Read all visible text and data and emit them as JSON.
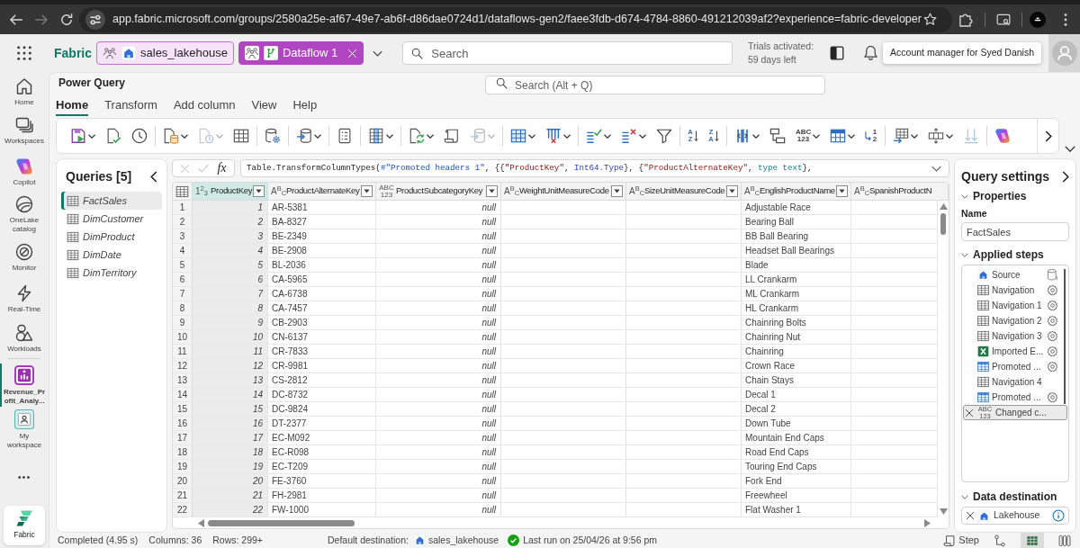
{
  "browser": {
    "nav_buttons": [
      {
        "kind": "back",
        "disabled": false
      },
      {
        "kind": "forward",
        "disabled": true
      },
      {
        "kind": "reload",
        "disabled": false
      }
    ],
    "url": "app.fabric.microsoft.com/groups/2580a25e-af67-49e7-ab6f-d86dae0724d1/dataflows-gen2/faee3fdb-d674-4784-8860-491212039af2?experience=fabric-developer"
  },
  "app_bar": {
    "brand": "Fabric",
    "breadcrumbs": [
      {
        "label": "sales_lakehouse",
        "kind": "lakehouse",
        "selected": false,
        "closable": false
      },
      {
        "label": "Dataflow 1",
        "kind": "dataflow",
        "selected": true,
        "closable": true
      }
    ],
    "search": {
      "placeholder": "Search"
    },
    "trial": {
      "title": "Trials activated:",
      "detail": "59 days left"
    },
    "tooltip": "Account manager for Syed Danish"
  },
  "nav": {
    "items": [
      {
        "label": "Home",
        "kind": "home",
        "selected": false
      },
      {
        "label": "Workspaces",
        "kind": "workspaces",
        "selected": false
      },
      {
        "label": "Copilot",
        "kind": "copilot",
        "selected": false
      },
      {
        "label": "OneLake catalog",
        "kind": "catalog",
        "selected": false
      },
      {
        "label": "Monitor",
        "kind": "monitor",
        "selected": false
      },
      {
        "label": "Real-Time",
        "kind": "realtime",
        "selected": false
      },
      {
        "label": "Workloads",
        "kind": "workloads",
        "selected": false
      }
    ],
    "open_items": [
      {
        "label": "Revenue_Profit_Analy...",
        "kind": "dataflow",
        "selected": true
      },
      {
        "label": "My workspace",
        "kind": "workspace",
        "selected": false
      }
    ],
    "more": "•••",
    "footer": {
      "label": "Fabric"
    }
  },
  "power_query": {
    "title": "Power Query",
    "search": {
      "placeholder": "Search (Alt + Q)"
    },
    "tabs": [
      {
        "label": "Home",
        "selected": true
      },
      {
        "label": "Transform",
        "selected": false
      },
      {
        "label": "Add column",
        "selected": false
      },
      {
        "label": "View",
        "selected": false
      },
      {
        "label": "Help",
        "selected": false
      }
    ]
  },
  "ribbon": {
    "groups": [
      [
        {
          "kind": "save",
          "dropdown": true,
          "disabled": false
        },
        {
          "kind": "validate",
          "dropdown": false,
          "disabled": false
        },
        {
          "kind": "schedule",
          "dropdown": false,
          "disabled": false
        }
      ],
      [
        {
          "kind": "get_data",
          "dropdown": true,
          "disabled": false
        },
        {
          "kind": "recent",
          "dropdown": true,
          "disabled": true
        },
        {
          "kind": "enter_data",
          "dropdown": false,
          "disabled": false
        }
      ],
      [
        {
          "kind": "options",
          "dropdown": false,
          "disabled": false
        }
      ],
      [
        {
          "kind": "destination",
          "dropdown": true,
          "disabled": false
        }
      ],
      [
        {
          "kind": "parameters",
          "dropdown": false,
          "disabled": false
        }
      ],
      [
        {
          "kind": "columns",
          "dropdown": true,
          "disabled": false
        }
      ],
      [
        {
          "kind": "refresh",
          "dropdown": true,
          "disabled": false
        },
        {
          "kind": "editor",
          "dropdown": false,
          "disabled": false
        },
        {
          "kind": "destination",
          "dropdown": true,
          "disabled": true
        }
      ],
      [
        {
          "kind": "choose_columns",
          "dropdown": true,
          "disabled": false
        },
        {
          "kind": "remove_columns",
          "dropdown": true,
          "disabled": false
        }
      ],
      [
        {
          "kind": "keep_rows",
          "dropdown": true,
          "disabled": false
        },
        {
          "kind": "remove_rows",
          "dropdown": true,
          "disabled": false
        },
        {
          "kind": "filter",
          "dropdown": false,
          "disabled": false
        }
      ],
      [
        {
          "kind": "sort_asc",
          "glyph": "A Z",
          "dropdown": false,
          "disabled": false
        },
        {
          "kind": "sort_desc",
          "glyph": "Z A",
          "dropdown": false,
          "disabled": false
        }
      ],
      [
        {
          "kind": "split",
          "dropdown": true,
          "disabled": false
        },
        {
          "kind": "group_by",
          "dropdown": false,
          "disabled": false
        },
        {
          "kind": "data_type",
          "glyph": "ABC 123",
          "dropdown": true,
          "disabled": false
        },
        {
          "kind": "table",
          "dropdown": true,
          "disabled": false
        },
        {
          "kind": "replace",
          "glyph": "1 2",
          "dropdown": false,
          "disabled": false
        }
      ],
      [
        {
          "kind": "merge",
          "dropdown": true,
          "disabled": false
        },
        {
          "kind": "expand",
          "dropdown": true,
          "disabled": false
        },
        {
          "kind": "combine",
          "dropdown": false,
          "disabled": true
        }
      ],
      [
        {
          "kind": "copilot",
          "dropdown": false,
          "disabled": false
        }
      ]
    ]
  },
  "queries": {
    "title": "Queries [5]",
    "items": [
      {
        "label": "FactSales",
        "selected": true
      },
      {
        "label": "DimCustomer",
        "selected": false
      },
      {
        "label": "DimProduct",
        "selected": false
      },
      {
        "label": "DimDate",
        "selected": false
      },
      {
        "label": "DimTerritory",
        "selected": false
      }
    ]
  },
  "formula_bar": {
    "function_icon": "fx",
    "tokens": [
      {
        "text": "Table.TransformColumnTypes(",
        "kind": "plain"
      },
      {
        "text": "#\"Promoted headers 1\"",
        "kind": "identifier"
      },
      {
        "text": ", {{",
        "kind": "plain"
      },
      {
        "text": "\"ProductKey\"",
        "kind": "string"
      },
      {
        "text": ", ",
        "kind": "plain"
      },
      {
        "text": "Int64.Type",
        "kind": "type"
      },
      {
        "text": "}, {",
        "kind": "plain"
      },
      {
        "text": "\"ProductAlternateKey\"",
        "kind": "string"
      },
      {
        "text": ", ",
        "kind": "plain"
      },
      {
        "text": "type text",
        "kind": "keyword"
      },
      {
        "text": "},",
        "kind": "plain"
      }
    ]
  },
  "table": {
    "columns": [
      {
        "name": "ProductKey",
        "kind": "number",
        "type_icon": "1$^{2}$$_{3}$",
        "selected": true,
        "filter": true
      },
      {
        "name": "ProductAlternateKey",
        "kind": "text",
        "type_icon": "A$^{B}$$_{C}$",
        "selected": false,
        "filter": true
      },
      {
        "name": "ProductSubcategoryKey",
        "kind": "any",
        "type_icon": "ABC 123",
        "selected": false,
        "filter": true
      },
      {
        "name": "WeightUnitMeasureCode",
        "kind": "text",
        "type_icon": "A$^{B}$$_{C}$",
        "selected": false,
        "filter": true
      },
      {
        "name": "SizeUnitMeasureCode",
        "kind": "text",
        "type_icon": "A$^{B}$$_{C}$",
        "selected": false,
        "filter": true
      },
      {
        "name": "EnglishProductName",
        "kind": "text",
        "type_icon": "A$^{B}$$_{C}$",
        "selected": false,
        "filter": true
      },
      {
        "name": "SpanishProductN",
        "kind": "text",
        "type_icon": "A$^{B}$$_{C}$",
        "selected": false,
        "filter": false
      }
    ],
    "rows": [
      {
        "row_number": "1",
        "product_key": "1",
        "product_alternate_key": "AR-5381",
        "product_subcategory_key": "null",
        "english_product_name": "Adjustable Race"
      },
      {
        "row_number": "2",
        "product_key": "2",
        "product_alternate_key": "BA-8327",
        "product_subcategory_key": "null",
        "english_product_name": "Bearing Ball"
      },
      {
        "row_number": "3",
        "product_key": "3",
        "product_alternate_key": "BE-2349",
        "product_subcategory_key": "null",
        "english_product_name": "BB Ball Bearing"
      },
      {
        "row_number": "4",
        "product_key": "4",
        "product_alternate_key": "BE-2908",
        "product_subcategory_key": "null",
        "english_product_name": "Headset Ball Bearings"
      },
      {
        "row_number": "5",
        "product_key": "5",
        "product_alternate_key": "BL-2036",
        "product_subcategory_key": "null",
        "english_product_name": "Blade"
      },
      {
        "row_number": "6",
        "product_key": "6",
        "product_alternate_key": "CA-5965",
        "product_subcategory_key": "null",
        "english_product_name": "LL Crankarm"
      },
      {
        "row_number": "7",
        "product_key": "7",
        "product_alternate_key": "CA-6738",
        "product_subcategory_key": "null",
        "english_product_name": "ML Crankarm"
      },
      {
        "row_number": "8",
        "product_key": "8",
        "product_alternate_key": "CA-7457",
        "product_subcategory_key": "null",
        "english_product_name": "HL Crankarm"
      },
      {
        "row_number": "9",
        "product_key": "9",
        "product_alternate_key": "CB-2903",
        "product_subcategory_key": "null",
        "english_product_name": "Chainring Bolts"
      },
      {
        "row_number": "10",
        "product_key": "10",
        "product_alternate_key": "CN-6137",
        "product_subcategory_key": "null",
        "english_product_name": "Chainring Nut"
      },
      {
        "row_number": "11",
        "product_key": "11",
        "product_alternate_key": "CR-7833",
        "product_subcategory_key": "null",
        "english_product_name": "Chainring"
      },
      {
        "row_number": "12",
        "product_key": "12",
        "product_alternate_key": "CR-9981",
        "product_subcategory_key": "null",
        "english_product_name": "Crown Race"
      },
      {
        "row_number": "13",
        "product_key": "13",
        "product_alternate_key": "CS-2812",
        "product_subcategory_key": "null",
        "english_product_name": "Chain Stays"
      },
      {
        "row_number": "14",
        "product_key": "14",
        "product_alternate_key": "DC-8732",
        "product_subcategory_key": "null",
        "english_product_name": "Decal 1"
      },
      {
        "row_number": "15",
        "product_key": "15",
        "product_alternate_key": "DC-9824",
        "product_subcategory_key": "null",
        "english_product_name": "Decal 2"
      },
      {
        "row_number": "16",
        "product_key": "16",
        "product_alternate_key": "DT-2377",
        "product_subcategory_key": "null",
        "english_product_name": "Down Tube"
      },
      {
        "row_number": "17",
        "product_key": "17",
        "product_alternate_key": "EC-M092",
        "product_subcategory_key": "null",
        "english_product_name": "Mountain End Caps"
      },
      {
        "row_number": "18",
        "product_key": "18",
        "product_alternate_key": "EC-R098",
        "product_subcategory_key": "null",
        "english_product_name": "Road End Caps"
      },
      {
        "row_number": "19",
        "product_key": "19",
        "product_alternate_key": "EC-T209",
        "product_subcategory_key": "null",
        "english_product_name": "Touring End Caps"
      },
      {
        "row_number": "20",
        "product_key": "20",
        "product_alternate_key": "FE-3760",
        "product_subcategory_key": "null",
        "english_product_name": "Fork End"
      },
      {
        "row_number": "21",
        "product_key": "21",
        "product_alternate_key": "FH-2981",
        "product_subcategory_key": "null",
        "english_product_name": "Freewheel"
      },
      {
        "row_number": "22",
        "product_key": "22",
        "product_alternate_key": "FW-1000",
        "product_subcategory_key": "null",
        "english_product_name": "Flat Washer 1"
      }
    ]
  },
  "query_settings": {
    "title": "Query settings",
    "properties": {
      "title": "Properties",
      "name_label": "Name",
      "name_value": "FactSales"
    },
    "applied_steps": {
      "title": "Applied steps",
      "steps": [
        {
          "label": "Source",
          "kind": "source",
          "settings": false,
          "selected": false
        },
        {
          "label": "Navigation",
          "kind": "table",
          "settings": true,
          "selected": false
        },
        {
          "label": "Navigation 1",
          "kind": "table",
          "settings": true,
          "selected": false
        },
        {
          "label": "Navigation 2",
          "kind": "table",
          "settings": true,
          "selected": false
        },
        {
          "label": "Navigation 3",
          "kind": "table",
          "settings": true,
          "selected": false
        },
        {
          "label": "Imported E...",
          "kind": "excel",
          "settings": true,
          "selected": false
        },
        {
          "label": "Promoted ...",
          "kind": "header_table",
          "settings": true,
          "selected": false
        },
        {
          "label": "Navigation 4",
          "kind": "table",
          "settings": false,
          "selected": false
        },
        {
          "label": "Promoted ...",
          "kind": "header_table",
          "settings": true,
          "selected": false
        },
        {
          "label": "Changed c...",
          "kind": "data_type",
          "glyph": "ABC 123",
          "settings": false,
          "selected": true
        }
      ]
    },
    "data_destination": {
      "title": "Data destination",
      "value": "Lakehouse"
    }
  },
  "status_bar": {
    "summary": [
      "Completed (4.95 s)",
      "Columns: 36",
      "Rows: 299+"
    ],
    "destination": {
      "label": "Default destination:",
      "value": "sales_lakehouse"
    },
    "last_run": "Last run on 25/04/26 at 9:56 pm",
    "step_button": "Step",
    "views": [
      {
        "kind": "diagram",
        "selected": false
      },
      {
        "kind": "table",
        "selected": true
      },
      {
        "kind": "schema",
        "selected": false
      }
    ]
  }
}
